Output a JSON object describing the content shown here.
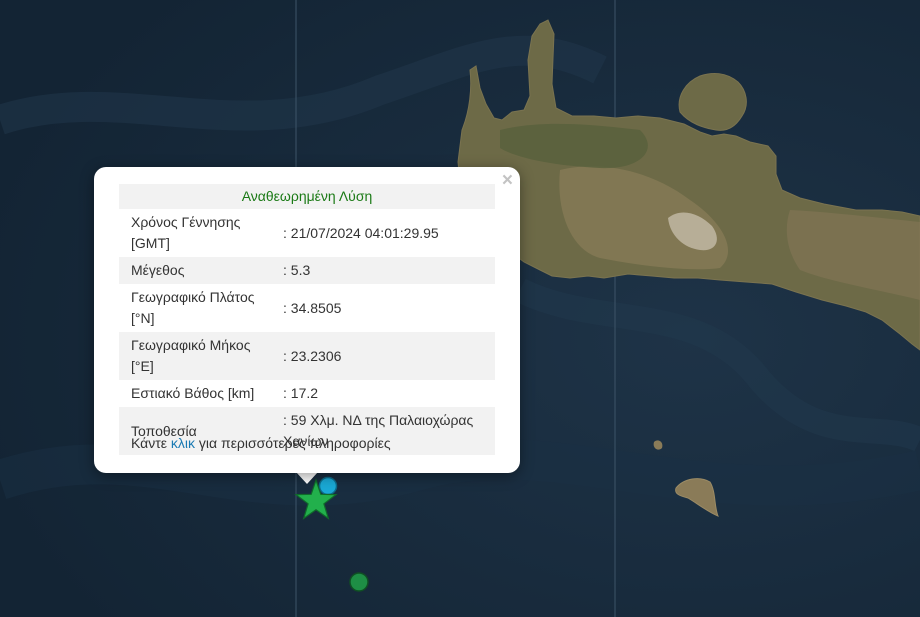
{
  "popup": {
    "title": "Αναθεωρημένη Λύση",
    "close_symbol": "×",
    "rows": [
      {
        "label": "Χρόνος Γέννησης [GMT]",
        "value": ": 21/07/2024 04:01:29.95"
      },
      {
        "label": "Μέγεθος",
        "value": ": 5.3"
      },
      {
        "label": "Γεωγραφικό Πλάτος [°N]",
        "value": ": 34.8505"
      },
      {
        "label": "Γεωγραφικό Μήκος [°E]",
        "value": ": 23.2306"
      },
      {
        "label": "Εστιακό Βάθος [km]",
        "value": ": 17.2"
      },
      {
        "label": "Τοποθεσία",
        "value": ": 59 Χλμ. ΝΔ της Παλαιοχώρας Χανίων"
      }
    ],
    "more_prefix": "Κάντε ",
    "more_link": "κλικ",
    "more_suffix": " για περισσότερες πληροφορίες"
  },
  "markers": {
    "epicenter": {
      "icon": "star-icon",
      "color": "#22b04c"
    },
    "recent_event": {
      "icon": "circle-icon",
      "color": "#1aa9d6"
    },
    "older_event": {
      "icon": "circle-icon",
      "color": "#1e8e45"
    }
  }
}
